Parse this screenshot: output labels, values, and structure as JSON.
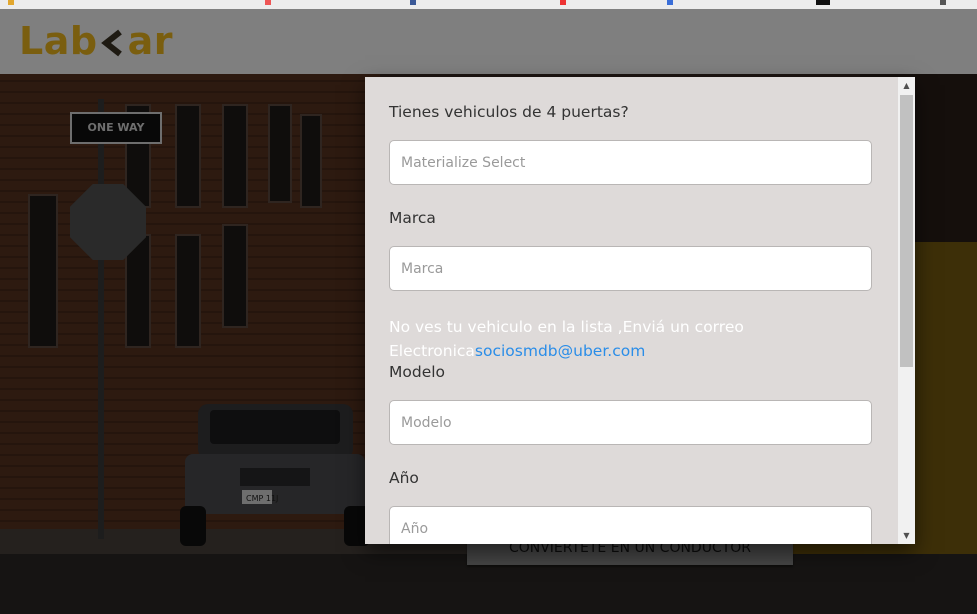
{
  "header": {
    "logo_left": "Lab",
    "logo_right": "ar"
  },
  "background": {
    "cta_label": "CONVIERTETE EN UN CONDUCTOR",
    "street_sign": "ONE WAY",
    "plate": "CMP 11J"
  },
  "modal": {
    "doors_question": "Tienes vehiculos de 4 puertas?",
    "doors_select_placeholder": "Materialize Select",
    "brand_label": "Marca",
    "brand_placeholder": "Marca",
    "note_text": "No ves tu vehiculo en la lista ,Enviá un correo Electronica",
    "note_email": "sociosmdb@uber.com",
    "model_label": "Modelo",
    "model_placeholder": "Modelo",
    "year_label": "Año",
    "year_placeholder": "Año"
  },
  "colors": {
    "logo": "#7a5e0f",
    "link": "#2a8de8",
    "modal_bg": "#dedad9"
  }
}
